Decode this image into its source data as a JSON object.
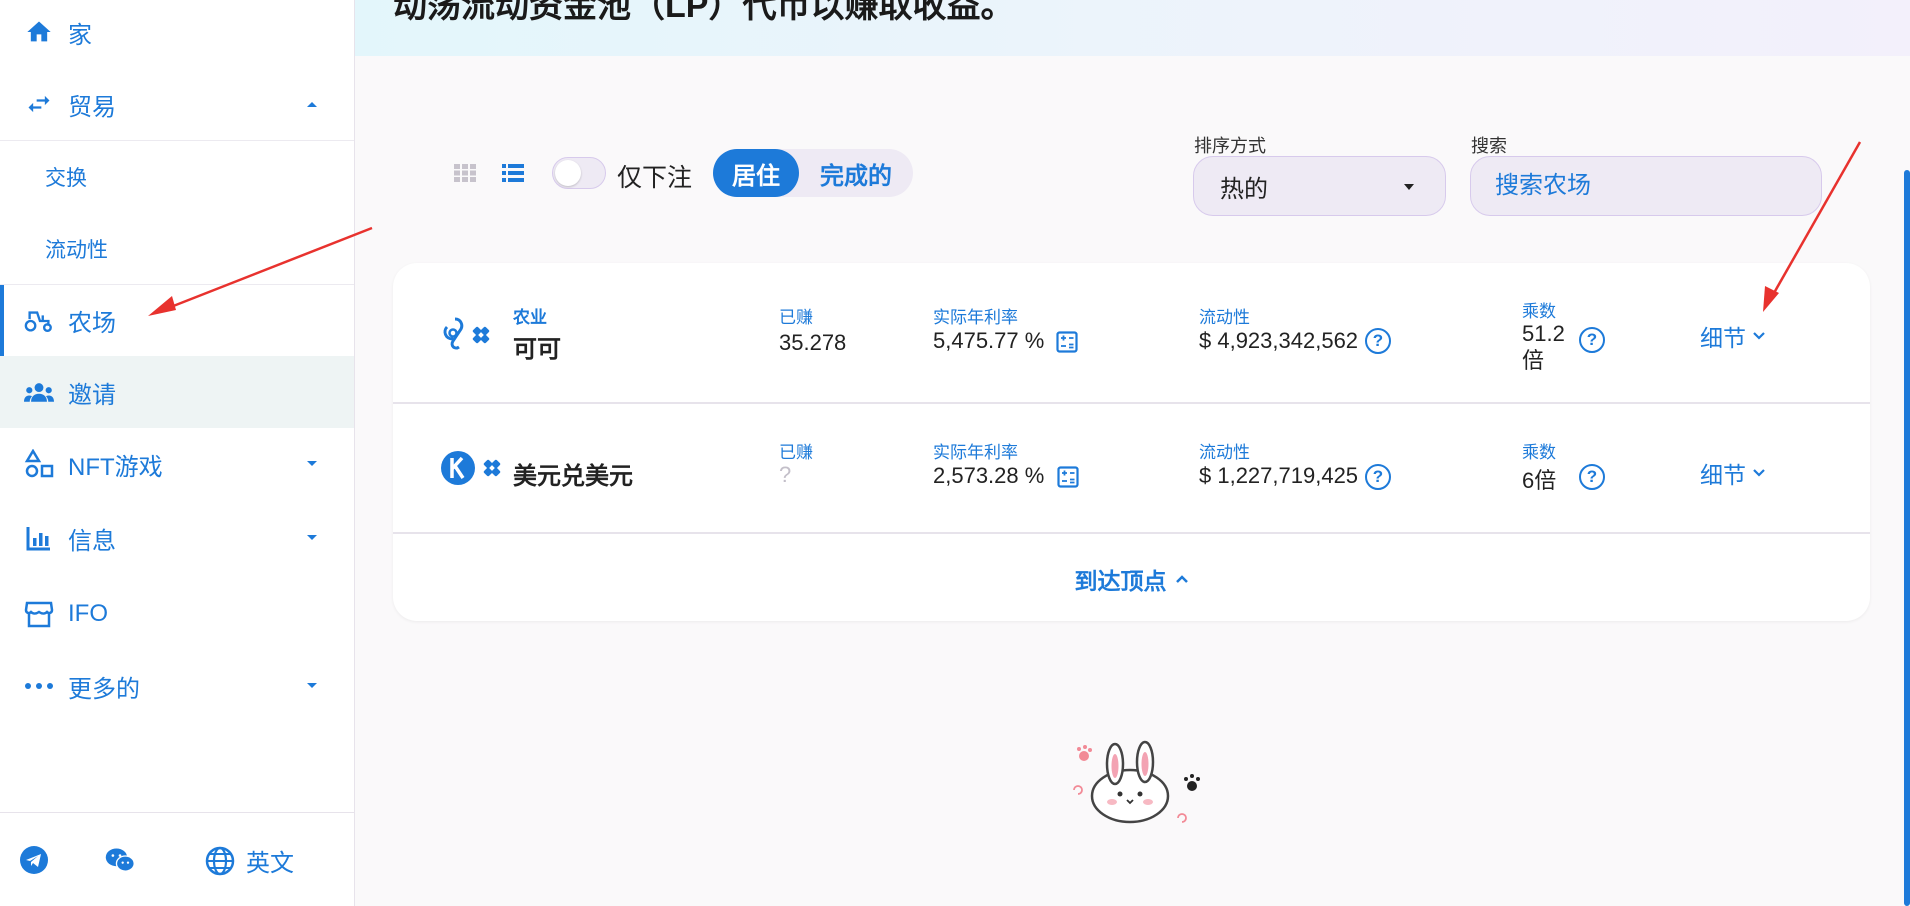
{
  "header": {
    "title": "动荡流动资金池（LP）代币以赚取收益。"
  },
  "sidebar": {
    "items": [
      {
        "label": "家",
        "icon": "home-icon"
      },
      {
        "label": "贸易",
        "icon": "swap-arrows-icon"
      },
      {
        "label": "农场",
        "icon": "tractor-icon"
      },
      {
        "label": "邀请",
        "icon": "users-icon"
      },
      {
        "label": "NFT游戏",
        "icon": "shapes-icon"
      },
      {
        "label": "信息",
        "icon": "bar-chart-icon"
      },
      {
        "label": "IFO",
        "icon": "storefront-icon"
      },
      {
        "label": "更多的",
        "icon": "more-dots-icon"
      }
    ],
    "sub_items": [
      {
        "label": "交换"
      },
      {
        "label": "流动性"
      }
    ],
    "footer": {
      "language": "英文"
    }
  },
  "controls": {
    "staked_only_label": "仅下注",
    "tab_live": "居住",
    "tab_finished": "完成的",
    "sort_label": "排序方式",
    "sort_value": "热的",
    "search_label": "搜索",
    "search_placeholder": "搜索农场"
  },
  "farms": [
    {
      "tag": "农业",
      "name": "可可",
      "earned_label": "已赚",
      "earned_value": "35.278",
      "apr_label": "实际年利率",
      "apr_value": "5,475.77 %",
      "liquidity_label": "流动性",
      "liquidity_value": "$ 4,923,342,562",
      "multiplier_label": "乘数",
      "multiplier_value_1": "51.2",
      "multiplier_value_2": "倍",
      "details_label": "细节"
    },
    {
      "name": "美元兑美元",
      "earned_label": "已赚",
      "earned_value": "?",
      "apr_label": "实际年利率",
      "apr_value": "2,573.28 %",
      "liquidity_label": "流动性",
      "liquidity_value": "$ 1,227,719,425",
      "multiplier_label": "乘数",
      "multiplier_value": "6倍",
      "details_label": "细节"
    }
  ],
  "to_top_label": "到达顶点",
  "colors": {
    "accent": "#1d7ad9",
    "annotation_arrow": "#e8322e"
  }
}
